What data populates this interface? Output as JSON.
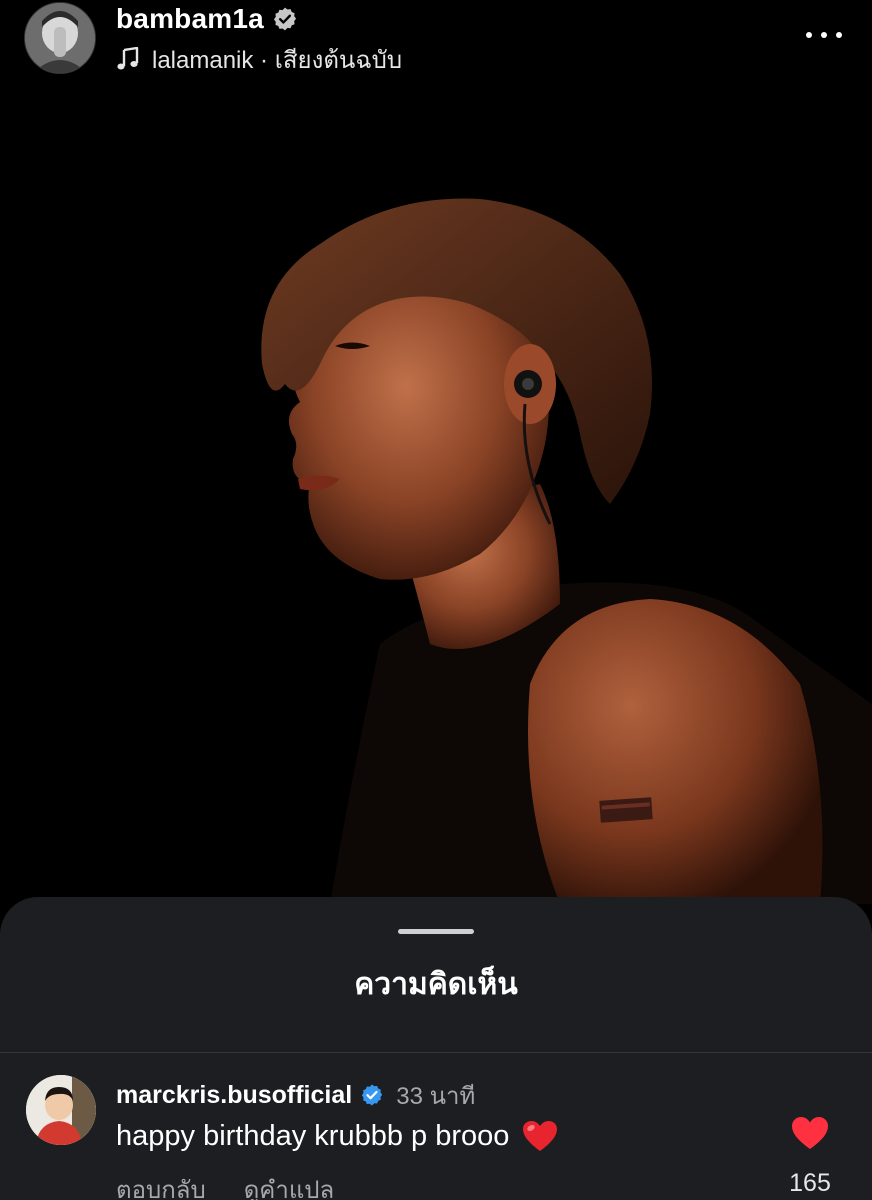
{
  "header": {
    "username": "bambam1a",
    "verified_icon": "verified-badge-icon",
    "audio_icon": "music-note-icon",
    "audio_text": "lalamanik · เสียงต้นฉบับ",
    "more_icon": "more-options-icon"
  },
  "sheet": {
    "title": "ความคิดเห็น"
  },
  "comments": [
    {
      "username": "marckris.busofficial",
      "verified": true,
      "time": "33 นาที",
      "text": "happy birthday krubbb p brooo",
      "emoji": "red-heart-emoji",
      "reply_label": "ตอบกลับ",
      "translate_label": "ดูคำแปล",
      "likes": "165",
      "liked": true
    }
  ],
  "colors": {
    "background": "#000000",
    "sheet": "#1c1e21",
    "verified_blue": "#3897f0",
    "verified_gray": "#c7c7c7",
    "heart_red": "#ff3040",
    "secondary_text": "#a8a8a8"
  }
}
